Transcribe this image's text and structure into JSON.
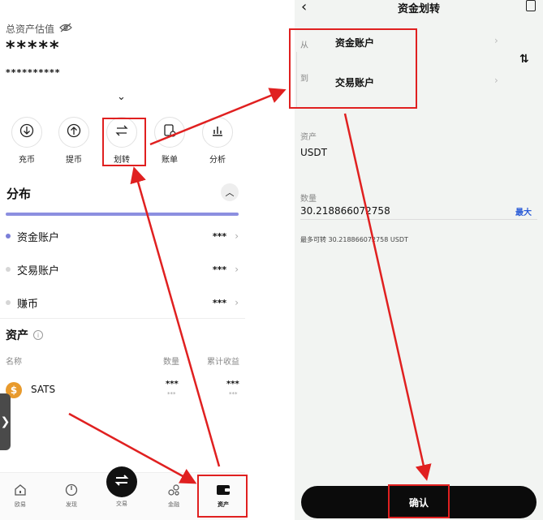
{
  "left": {
    "total_label": "总资产估值",
    "hidden_amount": "*****",
    "hidden_sub": "**********",
    "actions": [
      {
        "label": "充币",
        "icon": "deposit-icon"
      },
      {
        "label": "提币",
        "icon": "withdraw-icon"
      },
      {
        "label": "划转",
        "icon": "transfer-icon"
      },
      {
        "label": "账单",
        "icon": "bill-icon"
      },
      {
        "label": "分析",
        "icon": "analysis-icon"
      }
    ],
    "distribution_title": "分布",
    "distribution": [
      {
        "label": "资金账户",
        "value": "***",
        "dot_color": "#7b7fd8"
      },
      {
        "label": "交易账户",
        "value": "***",
        "dot_color": "#d6d6d6"
      },
      {
        "label": "赚币",
        "value": "***",
        "dot_color": "#d6d6d6"
      }
    ],
    "assets_title": "资产",
    "columns": {
      "name": "名称",
      "qty": "数量",
      "pnl": "累计收益"
    },
    "asset_rows": [
      {
        "name": "SATS",
        "qty": "***",
        "qty_sub": "***",
        "pnl": "***",
        "pnl_sub": "***"
      }
    ],
    "nav": [
      {
        "label": "欧易",
        "icon": "home-icon"
      },
      {
        "label": "发现",
        "icon": "discover-icon"
      },
      {
        "label": "交易",
        "icon": "trade-icon"
      },
      {
        "label": "金融",
        "icon": "finance-icon"
      },
      {
        "label": "资产",
        "icon": "wallet-icon"
      }
    ]
  },
  "right": {
    "title": "资金划转",
    "from_label": "从",
    "to_label": "到",
    "from_account": "资金账户",
    "to_account": "交易账户",
    "asset_label": "资产",
    "asset_value": "USDT",
    "qty_label": "数量",
    "qty_value": "30.218866072758",
    "max_label": "最大",
    "available": "最多可转 30.218866072758 USDT",
    "confirm_label": "确认"
  },
  "colors": {
    "highlight": "#e02020",
    "accent": "#2a5bd7",
    "bar": "#8c8fe0"
  }
}
